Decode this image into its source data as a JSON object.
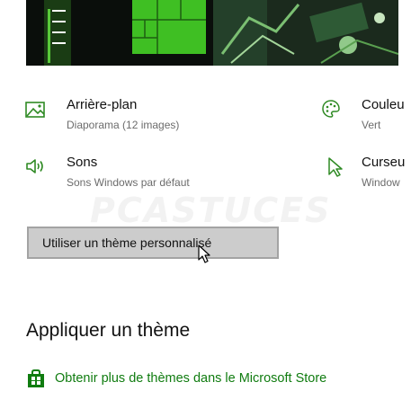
{
  "colors": {
    "accent": "#2f8a24",
    "link": "#107c10"
  },
  "preview": {
    "icon": "theme-preview-image"
  },
  "items": {
    "background": {
      "title": "Arrière-plan",
      "sub": "Diaporama (12 images)",
      "icon": "picture-icon"
    },
    "color": {
      "title": "Couleu",
      "sub": "Vert",
      "icon": "palette-icon"
    },
    "sounds": {
      "title": "Sons",
      "sub": "Sons Windows par défaut",
      "icon": "speaker-icon"
    },
    "cursor": {
      "title": "Curseu",
      "sub": "Window",
      "icon": "cursor-icon"
    }
  },
  "custom_button": {
    "label": "Utiliser un thème personnalisé"
  },
  "watermark": "PCASTUCES",
  "apply": {
    "title": "Appliquer un thème",
    "store_link": "Obtenir plus de thèmes dans le Microsoft Store",
    "store_icon": "store-bag-icon"
  }
}
